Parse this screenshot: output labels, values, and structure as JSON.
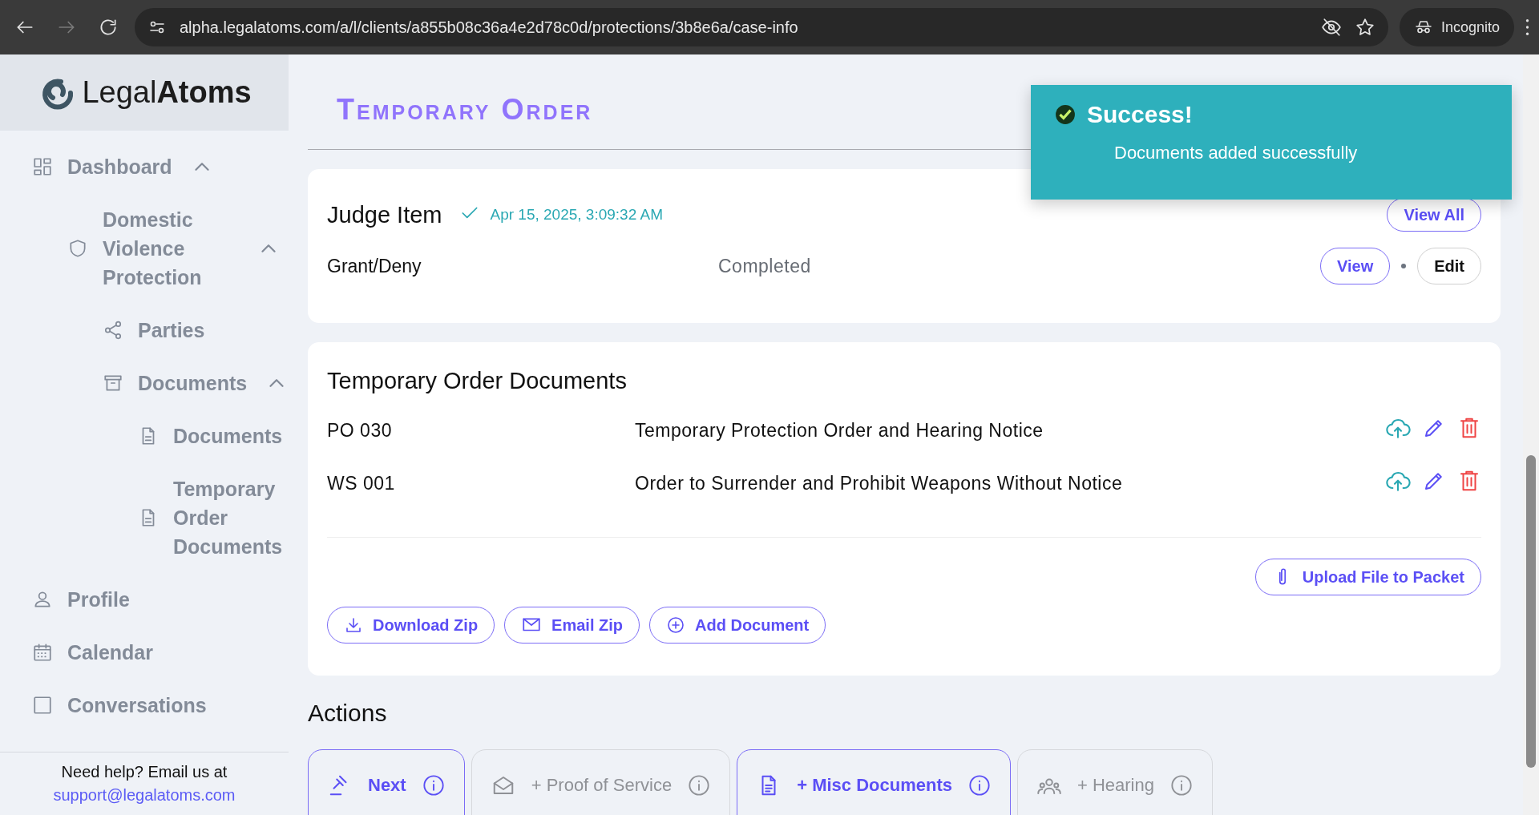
{
  "browser": {
    "url": "alpha.legalatoms.com/a/l/clients/a855b08c36a4e2d78c0d/protections/3b8e6a/case-info",
    "forward_disabled": true,
    "profile": "Incognito"
  },
  "sidebar": {
    "logo": {
      "light": "Legal",
      "bold": "Atoms"
    },
    "items": [
      {
        "label": "Dashboard",
        "expanded": true,
        "children": [
          {
            "label": "Domestic Violence Protection",
            "expanded": true,
            "children": [
              {
                "label": "Parties"
              },
              {
                "label": "Documents",
                "expanded": true,
                "children": [
                  {
                    "label": "Documents"
                  },
                  {
                    "label": "Temporary Order Documents"
                  }
                ]
              }
            ]
          }
        ]
      },
      {
        "label": "Profile"
      },
      {
        "label": "Calendar"
      },
      {
        "label": "Conversations"
      }
    ],
    "help": {
      "text": "Need help? Email us at",
      "email": "support@legalatoms.com"
    }
  },
  "page_title": "Temporary Order",
  "judge_card": {
    "title": "Judge Item",
    "timestamp": "Apr 15, 2025, 3:09:32 AM",
    "view_all": "View All",
    "row": {
      "name": "Grant/Deny",
      "status": "Completed",
      "view": "View",
      "edit": "Edit"
    }
  },
  "documents_card": {
    "title": "Temporary Order Documents",
    "rows": [
      {
        "code": "PO 030",
        "title": "Temporary Protection Order and Hearing Notice"
      },
      {
        "code": "WS 001",
        "title": "Order to Surrender and Prohibit Weapons Without Notice"
      }
    ],
    "upload": "Upload File to Packet",
    "buttons": [
      "Download Zip",
      "Email Zip",
      "Add Document"
    ]
  },
  "actions": {
    "title": "Actions",
    "items": [
      {
        "label": "Next",
        "disabled": false
      },
      {
        "label": "+ Proof of Service",
        "disabled": true
      },
      {
        "label": "+ Misc Documents",
        "disabled": false
      },
      {
        "label": "+ Hearing",
        "disabled": true
      }
    ]
  },
  "toast": {
    "title": "Success!",
    "message": "Documents added successfully"
  }
}
